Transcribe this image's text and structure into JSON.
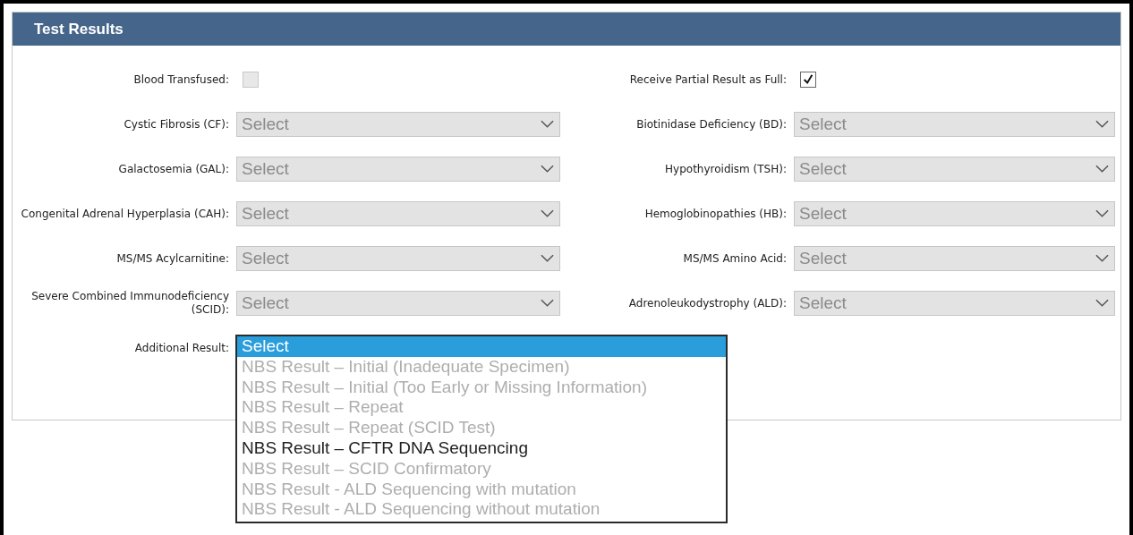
{
  "panel": {
    "title": "Test Results"
  },
  "rows": [
    [
      {
        "kind": "checkbox",
        "label": "Blood Transfused:",
        "checked": false,
        "disabled": true
      },
      {
        "kind": "checkbox",
        "label": "Receive Partial Result as Full:",
        "checked": true,
        "disabled": false
      }
    ],
    [
      {
        "kind": "select",
        "label": "Cystic Fibrosis (CF):",
        "value": "Select"
      },
      {
        "kind": "select",
        "label": "Biotinidase Deficiency (BD):",
        "value": "Select"
      }
    ],
    [
      {
        "kind": "select",
        "label": "Galactosemia (GAL):",
        "value": "Select"
      },
      {
        "kind": "select",
        "label": "Hypothyroidism (TSH):",
        "value": "Select"
      }
    ],
    [
      {
        "kind": "select",
        "label": "Congenital Adrenal Hyperplasia (CAH):",
        "value": "Select"
      },
      {
        "kind": "select",
        "label": "Hemoglobinopathies (HB):",
        "value": "Select"
      }
    ],
    [
      {
        "kind": "select",
        "label": "MS/MS Acylcarnitine:",
        "value": "Select"
      },
      {
        "kind": "select",
        "label": "MS/MS Amino Acid:",
        "value": "Select"
      }
    ],
    [
      {
        "kind": "select",
        "label": "Severe Combined Immunodeficiency (SCID):",
        "value": "Select"
      },
      {
        "kind": "select",
        "label": "Adrenoleukodystrophy (ALD):",
        "value": "Select"
      }
    ],
    [
      {
        "kind": "listbox",
        "label": "Additional Result:",
        "options": [
          {
            "text": "Select",
            "selected": true,
            "disabled": false
          },
          {
            "text": "NBS Result – Initial (Inadequate Specimen)",
            "selected": false,
            "disabled": true
          },
          {
            "text": "NBS Result – Initial (Too Early or Missing Information)",
            "selected": false,
            "disabled": true
          },
          {
            "text": "NBS Result – Repeat",
            "selected": false,
            "disabled": true
          },
          {
            "text": "NBS Result – Repeat (SCID Test)",
            "selected": false,
            "disabled": true
          },
          {
            "text": "NBS Result – CFTR DNA Sequencing",
            "selected": false,
            "disabled": false
          },
          {
            "text": "NBS Result – SCID Confirmatory",
            "selected": false,
            "disabled": true
          },
          {
            "text": "NBS Result - ALD Sequencing with mutation",
            "selected": false,
            "disabled": true
          },
          {
            "text": "NBS Result - ALD Sequencing without mutation",
            "selected": false,
            "disabled": true
          }
        ]
      }
    ]
  ]
}
